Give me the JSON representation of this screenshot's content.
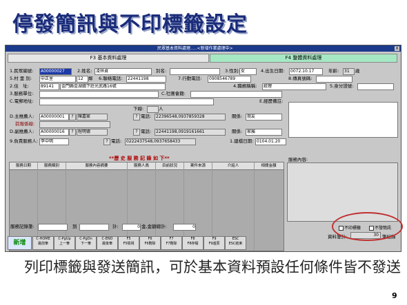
{
  "slide_title": "停發簡訊與不印標籤設定",
  "caption": "列印標籤與發送簡訊，可於基本資料預設任何條件皆不發送",
  "page_number": "9",
  "window": {
    "title": "民眾基本資料處理.....<新增作業處理中>",
    "close_label": "X",
    "tab1": "F3 基本資料處理",
    "tab2": "F4 整體資料處理"
  },
  "form": {
    "l_id": "1.民眾編號:",
    "v_id": "A00000027",
    "l_name": "2.姓名:",
    "v_name": "凌祥貞",
    "l_alias": "別名:",
    "l_sex": "3.性別:",
    "v_sex": "女",
    "l_birth": "4.出生日期:",
    "v_birth": "0072.10.17",
    "l_age": "年齡:",
    "v_age": "31",
    "u_age": "歲",
    "l_village": "5.村 里 別:",
    "v_village": "中正里",
    "v_lin": "12",
    "u_lin": "鄰",
    "l_phone": "6.聯絡電話:",
    "v_phone": "22441198",
    "l_mobile": "7.行動電話:",
    "v_mobile": "0908546789",
    "l_fax": "8.傳真號碼:",
    "l_addr": "2.住　址:",
    "v_zip": "89141",
    "v_addr": "金門縣金湖鎮下莊光武路16號",
    "l_job": "4.職務稱稱:",
    "v_job": "經理",
    "l_idtype": "5.身分證號:",
    "l_unit": "3.服務單位:",
    "l_social": "C.社團會籍:",
    "l_email": "C.電郵地址:",
    "l_other": "E.經歷備註:",
    "l_down": "下線:",
    "l_down_num": "人",
    "l_intro": "D.主推薦人:",
    "v_intro": "A00000001",
    "v_intro_name": "陳嘉家",
    "l_intro_phone": "電話:",
    "v_intro_phone": "22396548,0937859328",
    "l_rel": "關係:",
    "v_rel": "朋友",
    "l_prev": "前階係線:",
    "l_co": "D.副推薦人:",
    "v_co": "A00000016",
    "v_co_name": "程明德",
    "l_co_phone": "電話:",
    "v_co_phone": "22441198,0919161661",
    "l_co_rel": "關係:",
    "v_co_rel": "家屬",
    "l_staff": "9.負責服務人:",
    "v_staff": "李中明",
    "l_staff_phone": "電話:",
    "v_staff_phone": "0222437548,0937658433",
    "l_created": "1.建檔日期:",
    "v_created": "0104.01.20",
    "q": "?"
  },
  "history": {
    "title": "**歷 史 服 務 記 錄 如 下**",
    "columns": [
      "服務日期",
      "服務類別",
      "服務內容摘要",
      "服務人員",
      "目前狀況",
      "案件來源",
      "介紹人",
      "相關金額"
    ]
  },
  "notes_label": "服務內容:",
  "footer": {
    "l_total": "服務記錄筆:",
    "l_to": "到",
    "l_amt": "計:",
    "v_amt": "0",
    "l_sum": "金,金額總計:",
    "v_sum": "0"
  },
  "checkboxes": {
    "no_label": "不印標籤",
    "no_sms": "不發簡訊"
  },
  "count": {
    "label": "資料筆計:",
    "value": "30",
    "unit": "筆紀錄"
  },
  "buttons": [
    {
      "l1": "新增",
      "l2": ""
    },
    {
      "l1": "C-HOME",
      "l2": "最前筆"
    },
    {
      "l1": "C-PgUp",
      "l2": "上一筆"
    },
    {
      "l1": "C-PgDn",
      "l2": "下一筆"
    },
    {
      "l1": "C-END",
      "l2": "最後筆"
    },
    {
      "l1": "F5",
      "l2": "F5檢視"
    },
    {
      "l1": "F6",
      "l2": "F6刪除"
    },
    {
      "l1": "F7",
      "l2": "F7刪除"
    },
    {
      "l1": "F8",
      "l2": "F8存檔"
    },
    {
      "l1": "F9",
      "l2": "F9還原"
    },
    {
      "l1": "ESC",
      "l2": "ESC結束"
    }
  ]
}
